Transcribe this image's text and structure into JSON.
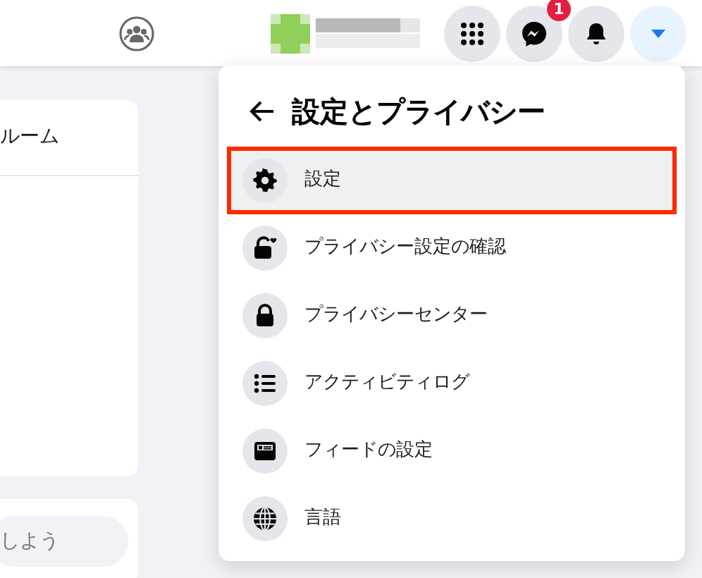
{
  "top_bar": {
    "messenger_badge": "1"
  },
  "left_panel": {
    "card_title": "ルーム",
    "composer": {
      "placeholder": "しよう"
    }
  },
  "menu": {
    "title": "設定とプライバシー",
    "items": [
      {
        "label": "設定",
        "selected": true
      },
      {
        "label": "プライバシー設定の確認",
        "selected": false
      },
      {
        "label": "プライバシーセンター",
        "selected": false
      },
      {
        "label": "アクティビティログ",
        "selected": false
      },
      {
        "label": "フィードの設定",
        "selected": false
      },
      {
        "label": "言語",
        "selected": false
      }
    ]
  }
}
